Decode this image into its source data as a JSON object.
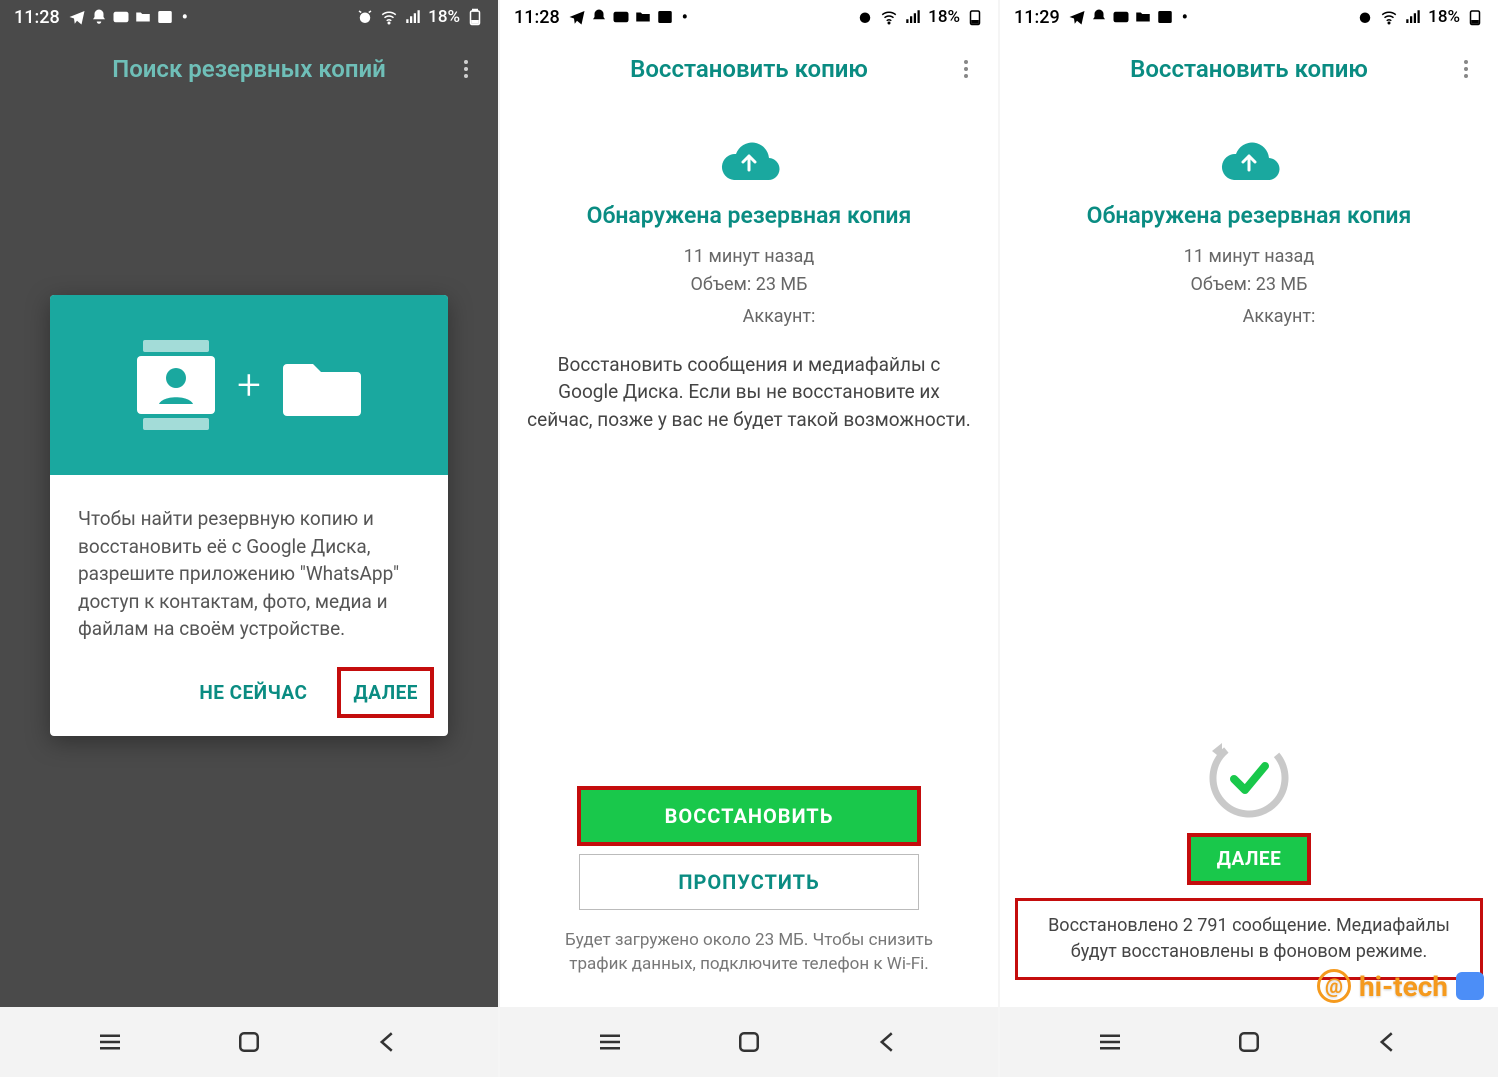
{
  "screens": [
    {
      "status": {
        "time": "11:28",
        "battery": "18%"
      },
      "header": {
        "title": "Поиск резервных копий"
      },
      "dialog": {
        "body": "Чтобы найти резервную копию и восстановить её с Google Диска, разрешите приложению \"WhatsApp\" доступ к контактам, фото, медиа и файлам на своём устройстве.",
        "not_now": "НЕ СЕЙЧАС",
        "next": "ДАЛЕЕ"
      }
    },
    {
      "status": {
        "time": "11:28",
        "battery": "18%"
      },
      "header": {
        "title": "Восстановить копию"
      },
      "found": {
        "title": "Обнаружена резервная копия",
        "when": "11 минут назад",
        "size": "Объем: 23 МБ",
        "account_label": "Аккаунт:",
        "desc": "Восстановить сообщения и медиафайлы с Google Диска. Если вы не восстановите их сейчас, позже у вас не будет такой возможности."
      },
      "actions": {
        "restore": "ВОССТАНОВИТЬ",
        "skip": "ПРОПУСТИТЬ"
      },
      "footer": "Будет загружено около 23 МБ. Чтобы снизить трафик данных, подключите телефон к Wi-Fi."
    },
    {
      "status": {
        "time": "11:29",
        "battery": "18%"
      },
      "header": {
        "title": "Восстановить копию"
      },
      "found": {
        "title": "Обнаружена резервная копия",
        "when": "11 минут назад",
        "size": "Объем: 23 МБ",
        "account_label": "Аккаунт:"
      },
      "actions": {
        "next": "ДАЛЕЕ"
      },
      "restored": "Восстановлено 2 791 сообщение. Медиафайлы будут восстановлены в фоновом режиме."
    }
  ],
  "watermark": {
    "text": "hi-tech"
  }
}
